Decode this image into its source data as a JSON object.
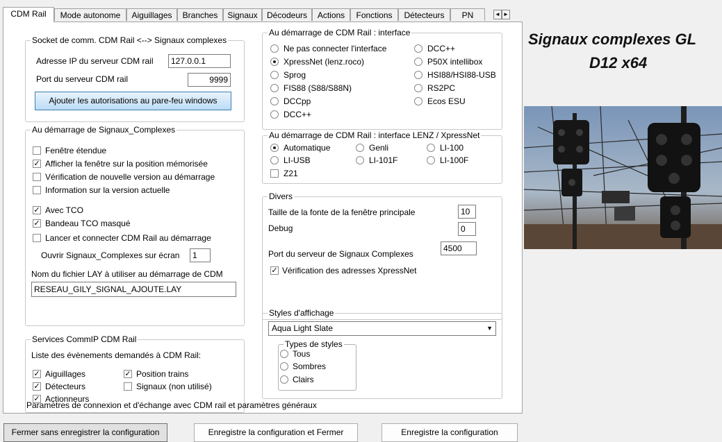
{
  "tabs": [
    "CDM Rail",
    "Mode autonome",
    "Aiguillages",
    "Branches",
    "Signaux",
    "Décodeurs",
    "Actions",
    "Fonctions",
    "Détecteurs",
    "PN"
  ],
  "tab_scroll": {
    "left": "◄",
    "right": "►"
  },
  "socket": {
    "legend": "Socket de comm. CDM Rail <--> Signaux complexes",
    "ip_label": "Adresse IP du serveur CDM rail",
    "ip_value": "127.0.0.1",
    "port_label": "Port du serveur CDM rail",
    "port_value": "9999",
    "firewall_button": "Ajouter les autorisations au pare-feu windows"
  },
  "startup_sc": {
    "legend": "Au démarrage de Signaux_Complexes",
    "checks": [
      {
        "label": "Fenêtre étendue",
        "checked": false
      },
      {
        "label": "Afficher la fenêtre sur la position mémorisée",
        "checked": true
      },
      {
        "label": "Vérification de nouvelle version au démarrage",
        "checked": false
      },
      {
        "label": "Information sur la version actuelle",
        "checked": false
      },
      {
        "label": "Avec TCO",
        "checked": true
      },
      {
        "label": "Bandeau TCO masqué",
        "checked": true
      },
      {
        "label": "Lancer et connecter CDM Rail au démarrage",
        "checked": false
      }
    ],
    "screen_label": "Ouvrir Signaux_Complexes sur écran",
    "screen_value": "1",
    "lay_label": "Nom du fichier LAY à utiliser au démarrage de CDM",
    "lay_value": "RESEAU_GILY_SIGNAL_AJOUTE.LAY"
  },
  "services": {
    "legend": "Services CommIP CDM Rail",
    "desc": "Liste des évènements demandés à CDM Rail:",
    "checks": [
      {
        "label": "Aiguillages",
        "checked": true
      },
      {
        "label": "Détecteurs",
        "checked": true
      },
      {
        "label": "Actionneurs",
        "checked": true
      },
      {
        "label": "Position trains",
        "checked": true
      },
      {
        "label": "Signaux (non utilisé)",
        "checked": false
      }
    ]
  },
  "footer_text": "Paramètres de connexion et d'échange avec CDM rail et paramètres généraux",
  "interface": {
    "legend": "Au démarrage de CDM Rail : interface",
    "left": [
      {
        "label": "Ne pas connecter l'interface",
        "selected": false
      },
      {
        "label": "XpressNet (lenz.roco)",
        "selected": true
      },
      {
        "label": "Sprog",
        "selected": false
      },
      {
        "label": "FIS88 (S88/S88N)",
        "selected": false
      },
      {
        "label": "DCCpp",
        "selected": false
      },
      {
        "label": "DCC++",
        "selected": false
      }
    ],
    "right": [
      {
        "label": "DCC++",
        "selected": false
      },
      {
        "label": "P50X intellibox",
        "selected": false
      },
      {
        "label": "HSI88/HSI88-USB",
        "selected": false
      },
      {
        "label": "RS2PC",
        "selected": false
      },
      {
        "label": "Ecos ESU",
        "selected": false
      }
    ]
  },
  "lenz": {
    "legend": "Au démarrage de CDM Rail : interface LENZ / XpressNet",
    "radios": [
      {
        "label": "Automatique",
        "selected": true
      },
      {
        "label": "Genli",
        "selected": false
      },
      {
        "label": "LI-100",
        "selected": false
      },
      {
        "label": "LI-USB",
        "selected": false
      },
      {
        "label": "LI-101F",
        "selected": false
      },
      {
        "label": "LI-100F",
        "selected": false
      }
    ],
    "z21_label": "Z21",
    "z21_checked": false
  },
  "divers": {
    "legend": "Divers",
    "font_label": "Taille de la fonte de la fenêtre principale",
    "font_value": "10",
    "debug_label": "Debug",
    "debug_value": "0",
    "port_label": "Port du serveur de Signaux Complexes",
    "port_value": "4500",
    "xn_label": "Vérification des adresses XpressNet",
    "xn_checked": true
  },
  "styles": {
    "legend": "Styles d'affichage",
    "selected": "Aqua Light Slate",
    "types_legend": "Types de styles",
    "types": [
      {
        "label": "Tous",
        "selected": false
      },
      {
        "label": "Sombres",
        "selected": false
      },
      {
        "label": "Clairs",
        "selected": false
      }
    ]
  },
  "buttons": {
    "close_nosave": "Fermer sans enregistrer la configuration",
    "save_close": "Enregistre la configuration et Fermer",
    "save": "Enregistre la configuration"
  },
  "side_title": {
    "line1": "Signaux complexes GL",
    "line2": "D12 x64"
  },
  "icons": {
    "check": "✓",
    "dropdown": "▼"
  }
}
